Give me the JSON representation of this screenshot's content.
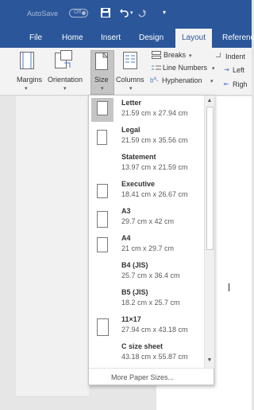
{
  "titlebar": {
    "autosave_label": "AutoSave",
    "autosave_state": "Off",
    "save_icon": "save-icon",
    "undo_icon": "undo-icon",
    "redo_icon": "redo-icon",
    "customize_icon": "customize-qat-icon"
  },
  "tabs": [
    "File",
    "Home",
    "Insert",
    "Design",
    "Layout",
    "Referenc"
  ],
  "active_tab": "Layout",
  "ribbon": {
    "margins": "Margins",
    "orientation": "Orientation",
    "size": "Size",
    "columns": "Columns",
    "breaks": "Breaks",
    "line_numbers": "Line Numbers",
    "hyphenation": "Hyphenation",
    "indent": "Indent",
    "left": "Left",
    "right": "Righ"
  },
  "size_menu": {
    "items": [
      {
        "name": "Letter",
        "dim": "21.59 cm x 27.94 cm"
      },
      {
        "name": "Legal",
        "dim": "21.59 cm x 35.56 cm"
      },
      {
        "name": "Statement",
        "dim": "13.97 cm x 21.59 cm"
      },
      {
        "name": "Executive",
        "dim": "18.41 cm x 26.67 cm"
      },
      {
        "name": "A3",
        "dim": "29.7 cm x 42 cm"
      },
      {
        "name": "A4",
        "dim": "21 cm x 29.7 cm"
      },
      {
        "name": "B4 (JIS)",
        "dim": "25.7 cm x 36.4 cm"
      },
      {
        "name": "B5 (JIS)",
        "dim": "18.2 cm x 25.7 cm"
      },
      {
        "name": "11×17",
        "dim": "27.94 cm x 43.18 cm"
      },
      {
        "name": "C size sheet",
        "dim": "43.18 cm x 55.87 cm"
      }
    ],
    "more": "More Paper Sizes..."
  },
  "colors": {
    "brand": "#2b579a",
    "ribbon_bg": "#f3f3f3",
    "selected_bg": "#c5c5c5"
  }
}
